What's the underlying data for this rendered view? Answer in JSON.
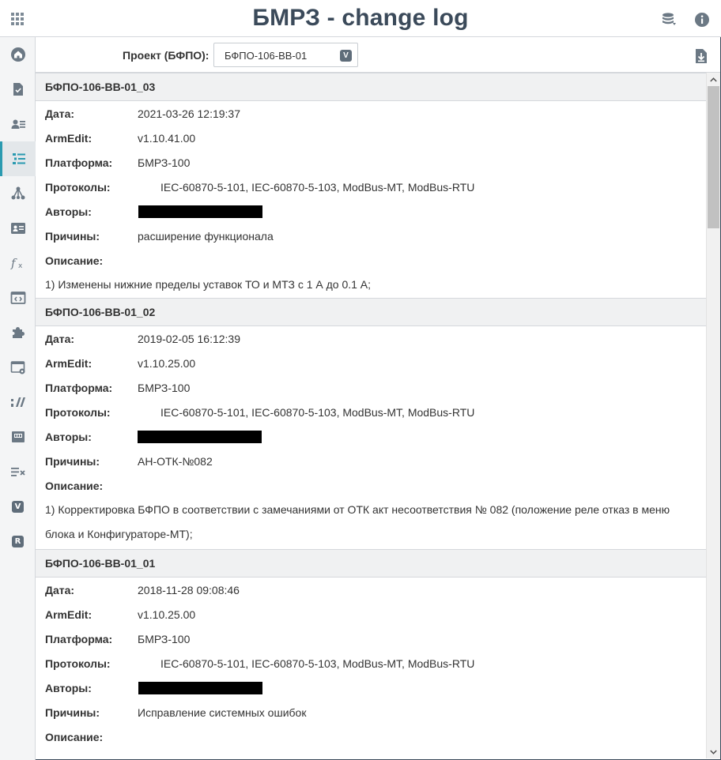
{
  "header": {
    "title": "БМРЗ - change log",
    "icons": [
      "apps-grid-icon",
      "database-icon",
      "info-icon"
    ]
  },
  "sidebar": {
    "items": [
      {
        "name": "home-icon"
      },
      {
        "name": "document-check-icon"
      },
      {
        "name": "user-list-icon"
      },
      {
        "name": "list-icon",
        "active": true
      },
      {
        "name": "network-icon"
      },
      {
        "name": "id-card-icon"
      },
      {
        "name": "function-icon"
      },
      {
        "name": "code-window-icon"
      },
      {
        "name": "puzzle-icon"
      },
      {
        "name": "window-settings-icon"
      },
      {
        "name": "signal-bars-icon"
      },
      {
        "name": "device-icon"
      },
      {
        "name": "compare-icon"
      },
      {
        "name": "v-badge-icon",
        "label": "V"
      },
      {
        "name": "r-badge-icon",
        "label": "R"
      }
    ],
    "badge_v": "V",
    "badge_r": "R"
  },
  "toolbar": {
    "project_label": "Проект (БФПО):",
    "project_value": "БФПО-106-ВВ-01",
    "arrow_label": "V"
  },
  "labels": {
    "date": "Дата:",
    "armedit": "ArmEdit:",
    "platform": "Платформа:",
    "protocols": "Протоколы:",
    "authors": "Авторы:",
    "reasons": "Причины:",
    "description": "Описание:"
  },
  "entries": [
    {
      "title": "БФПО-106-ВВ-01_03",
      "date": "2021-03-26 12:19:37",
      "armedit": "v1.10.41.00",
      "platform": "БМРЗ-100",
      "protocols": "IEC-60870-5-101, IEC-60870-5-103, ModBus-MT, ModBus-RTU",
      "reasons": "расширение функционала",
      "description": "1) Изменены нижние пределы уставок ТО и МТЗ с 1 А до 0.1 А;"
    },
    {
      "title": "БФПО-106-ВВ-01_02",
      "date": "2019-02-05 16:12:39",
      "armedit": "v1.10.25.00",
      "platform": "БМРЗ-100",
      "protocols": "IEC-60870-5-101, IEC-60870-5-103, ModBus-MT, ModBus-RTU",
      "reasons": "АН-ОТК-№082",
      "description": "1) Корректировка БФПО в соответствии с замечаниями от ОТК акт несоответствия № 082 (положение реле отказ в меню блока и Конфигураторе-МТ);"
    },
    {
      "title": "БФПО-106-ВВ-01_01",
      "date": "2018-11-28 09:08:46",
      "armedit": "v1.10.25.00",
      "platform": "БМРЗ-100",
      "protocols": "IEC-60870-5-101, IEC-60870-5-103, ModBus-MT, ModBus-RTU",
      "reasons": "Исправление системных ошибок",
      "description": ""
    }
  ],
  "colors": {
    "accent": "#2a9ab0",
    "title": "#3b4a5a",
    "icon": "#5f6d7a"
  }
}
